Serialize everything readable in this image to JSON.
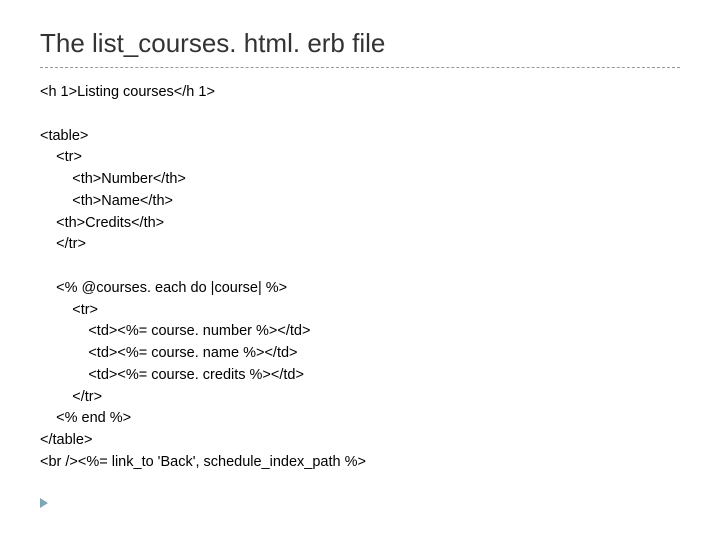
{
  "title": "The list_courses. html. erb file",
  "code_lines": [
    "<h 1>Listing courses</h 1>",
    "",
    "<table>",
    "    <tr>",
    "        <th>Number</th>",
    "        <th>Name</th>",
    "    <th>Credits</th>",
    "    </tr>",
    "",
    "    <% @courses. each do |course| %>",
    "        <tr>",
    "            <td><%= course. number %></td>",
    "            <td><%= course. name %></td>",
    "            <td><%= course. credits %></td>",
    "        </tr>",
    "    <% end %>",
    "</table>",
    "<br /><%= link_to 'Back', schedule_index_path %>"
  ]
}
